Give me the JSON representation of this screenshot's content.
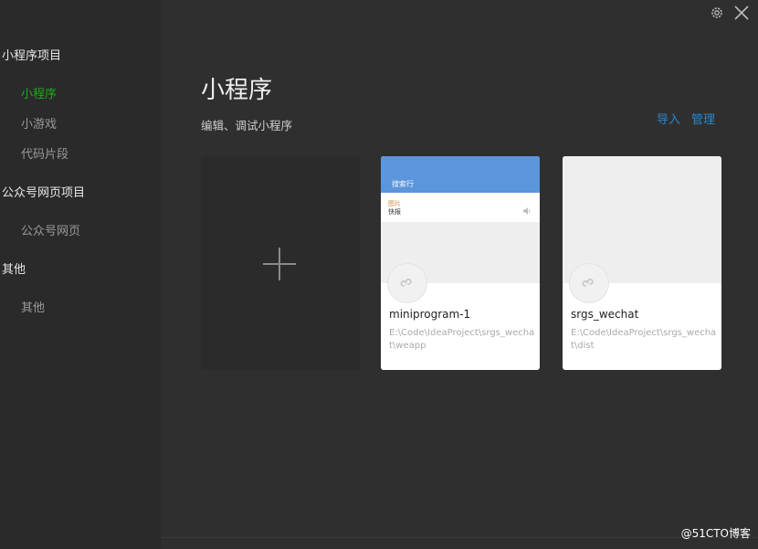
{
  "sidebar": {
    "groups": [
      {
        "title": "小程序项目",
        "items": [
          "小程序",
          "小游戏",
          "代码片段"
        ]
      },
      {
        "title": "公众号网页项目",
        "items": [
          "公众号网页"
        ]
      },
      {
        "title": "其他",
        "items": [
          "其他"
        ]
      }
    ],
    "active_item": "小程序"
  },
  "header": {
    "title": "小程序",
    "subtitle": "编辑、调试小程序",
    "import_label": "导入",
    "manage_label": "管理"
  },
  "cards": [
    {
      "name": "miniprogram-1",
      "path": "E:\\Code\\IdeaProject\\srgs_wechat\\weapp",
      "thumb_bar_text": "搜索行",
      "thumb_row_line1": "图片",
      "thumb_row_line2": "快报"
    },
    {
      "name": "srgs_wechat",
      "path": "E:\\Code\\IdeaProject\\srgs_wechat\\dist"
    }
  ],
  "icons": {
    "settings": "gear-icon",
    "close": "close-icon",
    "add": "plus-icon",
    "project_avatar": "miniprogram-logo-icon"
  },
  "colors": {
    "background": "#2f2f2f",
    "sidebar": "#2a2a2a",
    "accent_green": "#1aad19",
    "link_blue": "#2c87c8",
    "thumb_blue": "#5b95dc"
  },
  "watermark": "@51CTO博客"
}
